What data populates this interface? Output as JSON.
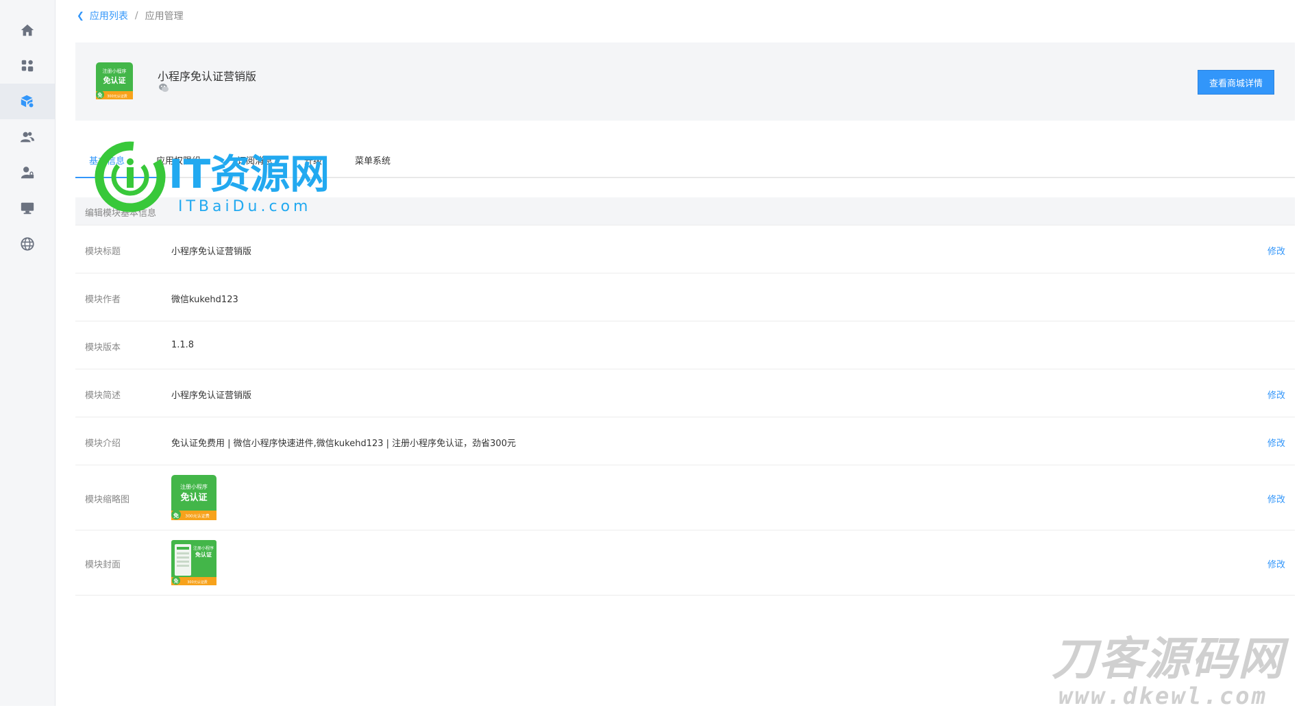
{
  "breadcrumb": {
    "back_label": "应用列表",
    "separator": "/",
    "current": "应用管理"
  },
  "app": {
    "title": "小程序免认证营销版",
    "icon_lines": [
      "注册小程序",
      "免认证",
      "免",
      "300元认证费"
    ],
    "shop_button": "查看商城详情"
  },
  "tabs": [
    {
      "label": "基本信息",
      "active": true
    },
    {
      "label": "应用权限组",
      "active": false
    },
    {
      "label": "订阅消息",
      "active": false
    },
    {
      "label": "升级",
      "active": false
    },
    {
      "label": "菜单系统",
      "active": false
    }
  ],
  "section": {
    "title": "编辑模块基本信息"
  },
  "rows": [
    {
      "label": "模块标题",
      "value": "小程序免认证营销版",
      "edit": "修改"
    },
    {
      "label": "模块作者",
      "value": "微信kukehd123",
      "edit": ""
    },
    {
      "label": "模块版本",
      "value": "1.1.8",
      "edit": ""
    },
    {
      "label": "模块简述",
      "value": "小程序免认证营销版",
      "edit": "修改"
    },
    {
      "label": "模块介绍",
      "value": "免认证免费用 | 微信小程序快速进件,微信kukehd123 | 注册小程序免认证，劲省300元",
      "edit": "修改"
    },
    {
      "label": "模块缩略图",
      "value": "",
      "edit": "修改"
    },
    {
      "label": "模块封面",
      "value": "",
      "edit": "修改"
    }
  ],
  "sidebar": [
    {
      "icon": "home-icon"
    },
    {
      "icon": "apps-icon"
    },
    {
      "icon": "module-icon",
      "active": true
    },
    {
      "icon": "users-icon"
    },
    {
      "icon": "user-lock-icon"
    },
    {
      "icon": "monitor-icon"
    },
    {
      "icon": "globe-icon"
    }
  ],
  "watermarks": {
    "itbaidu_cn": "IT资源网",
    "itbaidu_en": "ITBaiDu.com",
    "dkewl_cn": "刀客源码网",
    "dkewl_en": "www.dkewl.com"
  },
  "colors": {
    "accent": "#3296fa",
    "sidebar_bg": "#f5f6f8",
    "icon_green": "#43b649",
    "icon_orange": "#f7a21b"
  }
}
